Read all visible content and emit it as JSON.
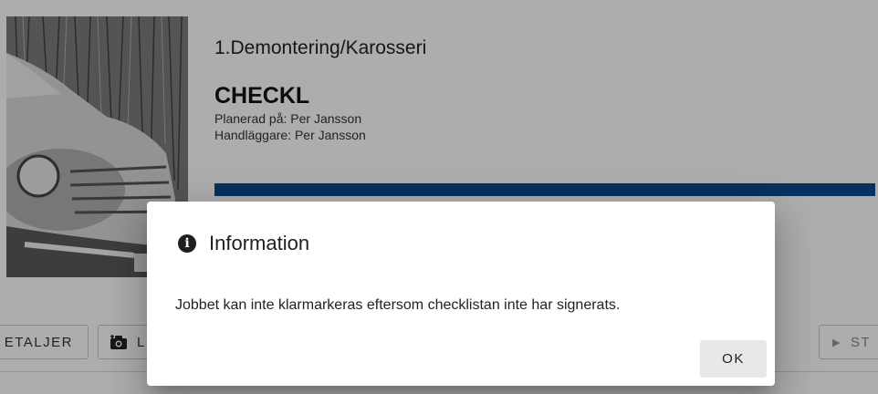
{
  "job": {
    "title": "1.Demontering/Karosseri",
    "heading": "CHECKL",
    "planned_on": "Planerad på: Per Jansson",
    "handler": "Handläggare: Per Jansson",
    "progress_percent": 100,
    "progress_color": "#0b4a8c"
  },
  "actions": {
    "details_label": "ETALJER",
    "photo_label": "L",
    "photo_icon": "camera-icon",
    "start_label": "ST",
    "start_icon": "play-icon"
  },
  "dialog": {
    "icon": "info-icon",
    "title": "Information",
    "message": "Jobbet kan inte klarmarkeras eftersom checklistan inte har signerats.",
    "ok_label": "OK"
  }
}
